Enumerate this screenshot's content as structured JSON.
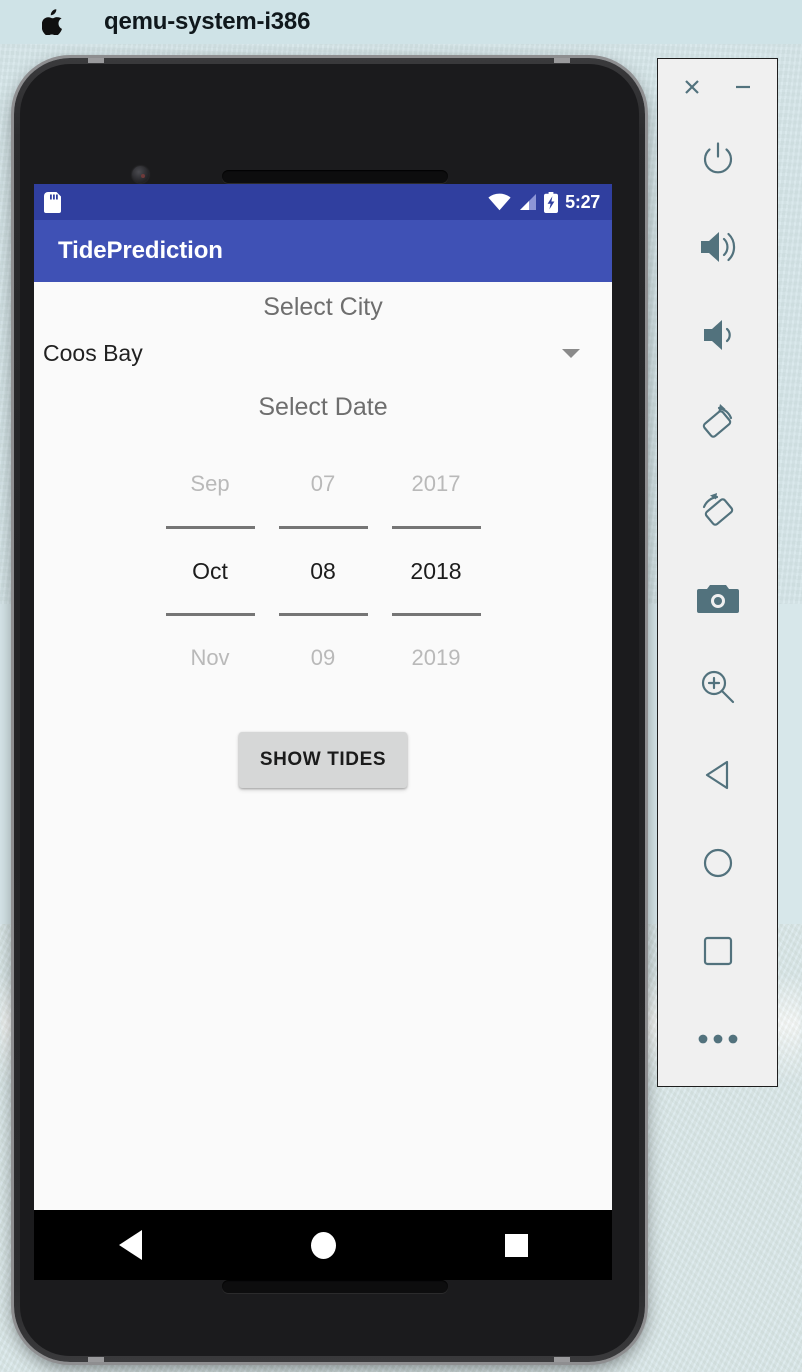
{
  "menubar": {
    "apple_icon": "apple-logo-icon",
    "app_title": "qemu-system-i386"
  },
  "phone": {
    "statusbar": {
      "sdcard_icon": "sd-card-icon",
      "wifi_icon": "wifi-icon",
      "signal_icon": "cellular-signal-icon",
      "battery_icon": "battery-charging-icon",
      "clock": "5:27"
    },
    "appbar": {
      "title": "TidePrediction"
    },
    "content": {
      "city_label": "Select City",
      "city_spinner": {
        "value": "Coos Bay",
        "caret_icon": "chevron-down-icon"
      },
      "date_label": "Select Date",
      "date_picker": {
        "month": {
          "prev": "Sep",
          "selected": "Oct",
          "next": "Nov"
        },
        "day": {
          "prev": "07",
          "selected": "08",
          "next": "09"
        },
        "year": {
          "prev": "2017",
          "selected": "2018",
          "next": "2019"
        }
      },
      "show_tides_button": "SHOW TIDES"
    },
    "navbar": {
      "back_icon": "back-triangle-icon",
      "home_icon": "home-circle-icon",
      "recents_icon": "recents-square-icon"
    }
  },
  "emulator_toolbar": {
    "close_label": "×",
    "minimize_label": "−",
    "buttons": [
      {
        "name": "power-button",
        "icon": "power-icon"
      },
      {
        "name": "volume-up-button",
        "icon": "volume-up-icon"
      },
      {
        "name": "volume-down-button",
        "icon": "volume-down-icon"
      },
      {
        "name": "rotate-left-button",
        "icon": "rotate-left-icon"
      },
      {
        "name": "rotate-right-button",
        "icon": "rotate-right-icon"
      },
      {
        "name": "screenshot-button",
        "icon": "camera-icon"
      },
      {
        "name": "zoom-button",
        "icon": "magnifier-plus-icon"
      },
      {
        "name": "back-button",
        "icon": "back-triangle-icon"
      },
      {
        "name": "home-button",
        "icon": "home-circle-icon"
      },
      {
        "name": "overview-button",
        "icon": "overview-square-icon"
      },
      {
        "name": "more-button",
        "icon": "more-dots-icon"
      }
    ]
  },
  "colors": {
    "statusbar": "#303f9f",
    "appbar": "#3f51b5",
    "toolbar_icon": "#52727d",
    "button_bg": "#d6d7d7",
    "menubar_bg": "#cfe3e7"
  }
}
